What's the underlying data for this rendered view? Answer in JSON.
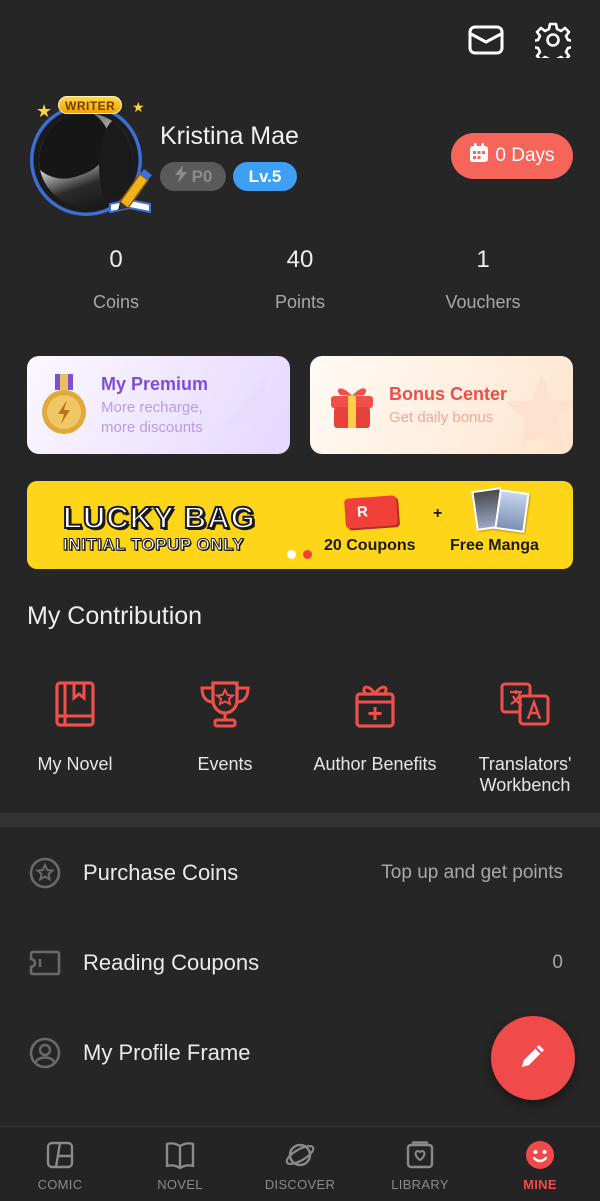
{
  "header": {
    "mail_icon": "mail-icon",
    "settings_icon": "gear-icon"
  },
  "profile": {
    "badge_text": "WRITER",
    "name": "Kristina Mae",
    "power_badge": "P0",
    "level_badge": "Lv.5",
    "days_button": "0 Days"
  },
  "stats": [
    {
      "value": "0",
      "label": "Coins"
    },
    {
      "value": "40",
      "label": "Points"
    },
    {
      "value": "1",
      "label": "Vouchers"
    }
  ],
  "cards": {
    "premium": {
      "title": "My Premium",
      "subtitle_line1": "More recharge,",
      "subtitle_line2": "more discounts"
    },
    "bonus": {
      "title": "Bonus Center",
      "subtitle": "Get daily bonus"
    }
  },
  "banner": {
    "title": "LUCKY BAG",
    "subtitle": "INITIAL TOPUP ONLY",
    "coupon_icon_text": "R",
    "plus": "+",
    "coupons_text": "20 Coupons",
    "manga_text": "Free Manga"
  },
  "contribution": {
    "title": "My Contribution",
    "items": [
      {
        "label": "My Novel",
        "icon": "book-icon"
      },
      {
        "label": "Events",
        "icon": "trophy-icon"
      },
      {
        "label": "Author Benefits",
        "icon": "gift-icon"
      },
      {
        "label_line1": "Translators'",
        "label_line2": "Workbench",
        "icon": "translate-icon"
      }
    ]
  },
  "menu": [
    {
      "label": "Purchase Coins",
      "value": "Top up and get points",
      "icon": "coin-star-icon"
    },
    {
      "label": "Reading Coupons",
      "value": "0",
      "icon": "ticket-icon"
    },
    {
      "label": "My Profile Frame",
      "value": "",
      "icon": "profile-frame-icon"
    }
  ],
  "nav": [
    {
      "label": "COMIC",
      "icon": "comic-icon"
    },
    {
      "label": "NOVEL",
      "icon": "novel-icon"
    },
    {
      "label": "DISCOVER",
      "icon": "planet-icon"
    },
    {
      "label": "LIBRARY",
      "icon": "library-icon"
    },
    {
      "label": "MINE",
      "icon": "mine-face-icon",
      "active": true
    }
  ],
  "colors": {
    "background": "#262626",
    "accent_red": "#f04a4a",
    "level_blue": "#3da0f5",
    "banner_yellow": "#ffd51a",
    "premium_purple": "#7b4fd6",
    "bonus_red": "#e9504a"
  }
}
